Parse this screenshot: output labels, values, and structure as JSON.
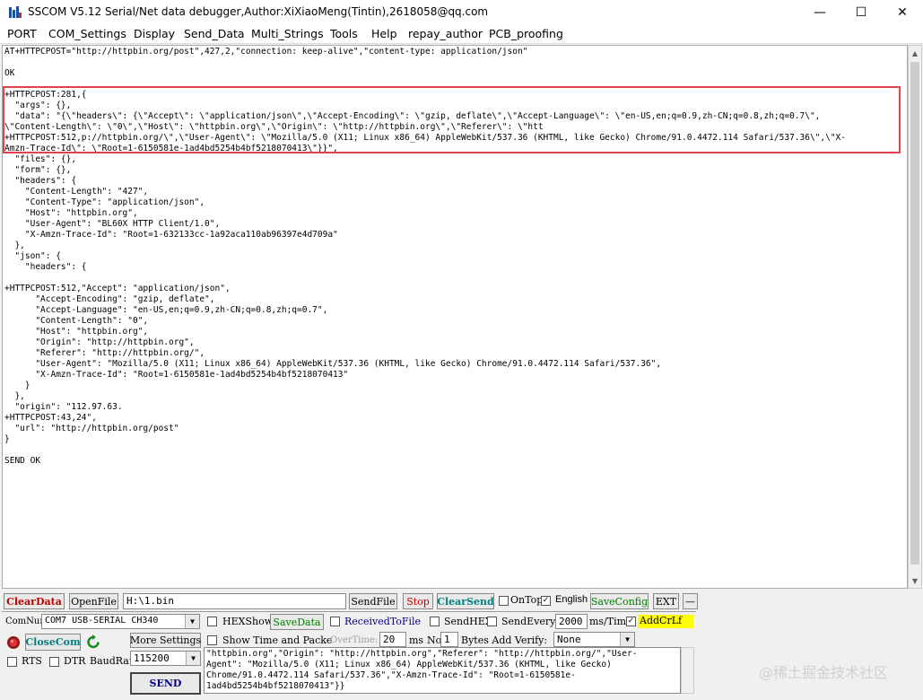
{
  "window": {
    "title": "SSCOM V5.12 Serial/Net data debugger,Author:XiXiaoMeng(Tintin),2618058@qq.com",
    "minimize": "—",
    "maximize": "☐",
    "close": "✕"
  },
  "menu": [
    "PORT",
    "COM_Settings",
    "Display",
    "Send_Data",
    "Multi_Strings",
    "Tools",
    "Help",
    "repay_author",
    "PCB_proofing"
  ],
  "output_text": "AT+HTTPCPOST=\"http://httpbin.org/post\",427,2,\"connection: keep-alive\",\"content-type: application/json\"\n\nOK\n\n+HTTPCPOST:281,{\n  \"args\": {},\n  \"data\": \"{\\\"headers\\\": {\\\"Accept\\\": \\\"application/json\\\",\\\"Accept-Encoding\\\": \\\"gzip, deflate\\\",\\\"Accept-Language\\\": \\\"en-US,en;q=0.9,zh-CN;q=0.8,zh;q=0.7\\\",\n\\\"Content-Length\\\": \\\"0\\\",\\\"Host\\\": \\\"httpbin.org\\\",\\\"Origin\\\": \\\"http://httpbin.org\\\",\\\"Referer\\\": \\\"htt\n+HTTPCPOST:512,p://httpbin.org/\\\",\\\"User-Agent\\\": \\\"Mozilla/5.0 (X11; Linux x86_64) AppleWebKit/537.36 (KHTML, like Gecko) Chrome/91.0.4472.114 Safari/537.36\\\",\\\"X-\nAmzn-Trace-Id\\\": \\\"Root=1-6150581e-1ad4bd5254b4bf5218070413\\\"}}\",\n  \"files\": {},\n  \"form\": {},\n  \"headers\": {\n    \"Content-Length\": \"427\",\n    \"Content-Type\": \"application/json\",\n    \"Host\": \"httpbin.org\",\n    \"User-Agent\": \"BL60X HTTP Client/1.0\",\n    \"X-Amzn-Trace-Id\": \"Root=1-632133cc-1a92aca110ab96397e4d709a\"\n  },\n  \"json\": {\n    \"headers\": {\n\n+HTTPCPOST:512,\"Accept\": \"application/json\",\n      \"Accept-Encoding\": \"gzip, deflate\",\n      \"Accept-Language\": \"en-US,en;q=0.9,zh-CN;q=0.8,zh;q=0.7\",\n      \"Content-Length\": \"0\",\n      \"Host\": \"httpbin.org\",\n      \"Origin\": \"http://httpbin.org\",\n      \"Referer\": \"http://httpbin.org/\",\n      \"User-Agent\": \"Mozilla/5.0 (X11; Linux x86_64) AppleWebKit/537.36 (KHTML, like Gecko) Chrome/91.0.4472.114 Safari/537.36\",\n      \"X-Amzn-Trace-Id\": \"Root=1-6150581e-1ad4bd5254b4bf5218070413\"\n    }\n  },\n  \"origin\": \"112.97.63.\n+HTTPCPOST:43,24\",\n  \"url\": \"http://httpbin.org/post\"\n}\n\nSEND OK",
  "row1": {
    "clear_data": "ClearData",
    "open_file": "OpenFile",
    "file_path": "H:\\1.bin",
    "send_file": "SendFile",
    "stop": "Stop",
    "clear_send": "ClearSend",
    "on_top": "OnTop",
    "english": "English",
    "save_config": "SaveConfig",
    "ext": "EXT",
    "dash": "—"
  },
  "row2": {
    "com_num_label": "ComNum",
    "com_port": "COM7 USB-SERIAL CH340",
    "hex_show": "HEXShow",
    "save_data": "SaveData",
    "received_to_file": "ReceivedToFile",
    "send_hex": "SendHEX",
    "send_every": "SendEvery:",
    "interval": "2000",
    "interval_unit": "ms/Tim",
    "add_crlf": "AddCrLf"
  },
  "row3": {
    "close_com": "CloseCom",
    "more_settings": "More Settings",
    "show_time": "Show Time and Packe",
    "overtime_label": "OverTime:",
    "overtime_value": "20",
    "overtime_unit": "ms",
    "no_label": "No",
    "no_value": "1",
    "bytes_add": "Bytes Add Verify:",
    "verify": "None"
  },
  "row4": {
    "rts": "RTS",
    "dtr": "DTR",
    "baudrate_label": "BaudRat",
    "baudrate": "115200",
    "send": "SEND"
  },
  "send_text": "\"httpbin.org\",\"Origin\": \"http://httpbin.org\",\"Referer\": \"http://httpbin.org/\",\"User-\nAgent\": \"Mozilla/5.0 (X11; Linux x86_64) AppleWebKit/537.36 (KHTML, like Gecko)\nChrome/91.0.4472.114 Safari/537.36\",\"X-Amzn-Trace-Id\": \"Root=1-6150581e-\n1ad4bd5254b4bf5218070413\"}}",
  "watermark": "@稀土掘金技术社区",
  "checkboxes": {
    "on_top": true,
    "add_crlf": true,
    "english": true
  },
  "colors": {
    "clear_data": "#c00000",
    "stop": "#c00000",
    "clear_send": "#008080",
    "save_config": "#008000",
    "save_data": "#008000",
    "received_to_file": "#000080",
    "add_crlf_bg": "#ffff00",
    "highlight": "#e0434b",
    "close_com": "#008080"
  },
  "icons": {
    "app": "sscom-app-icon",
    "com_status": "red-status-icon",
    "refresh": "green-refresh-icon"
  }
}
